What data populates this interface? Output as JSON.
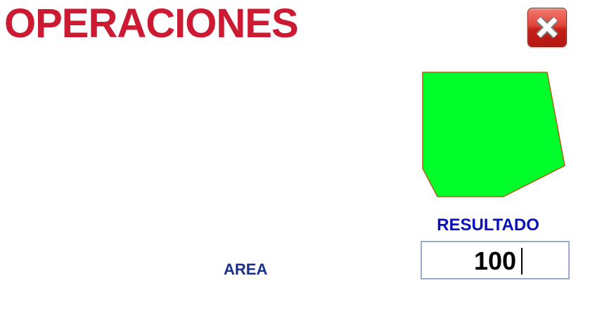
{
  "header": {
    "title": "OPERACIONES",
    "close_button": {
      "icon": "close-icon"
    }
  },
  "figure": {
    "shape": "pentagon-polygon",
    "fill_color": "#00ff2a",
    "stroke_color": "#b85a1a"
  },
  "result": {
    "label": "RESULTADO",
    "value": "100"
  },
  "operation": {
    "label": "AREA"
  },
  "colors": {
    "title": "#cc1a33",
    "result_label": "#0a10b8",
    "area_label": "#1a2f8c",
    "close_button": "#d42a22"
  }
}
